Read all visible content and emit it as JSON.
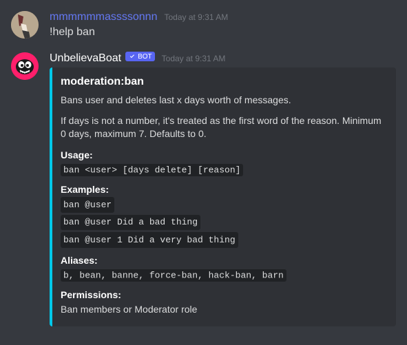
{
  "messages": {
    "user": {
      "username": "mmmmmmassssonnn",
      "username_color": "#6478f2",
      "timestamp": "Today at 9:31 AM",
      "text": "!help ban"
    },
    "bot": {
      "username": "UnbelievaBoat",
      "bot_tag_text": "BOT",
      "timestamp": "Today at 9:31 AM",
      "embed": {
        "accent_color": "#00c8e9",
        "title": "moderation:ban",
        "description_1": "Bans user and deletes last x days worth of messages.",
        "description_2": "If days is not a number, it's treated as the first word of the reason. Minimum 0 days, maximum 7. Defaults to 0.",
        "fields": {
          "usage": {
            "name": "Usage:",
            "value": "ban <user> [days delete] [reason]"
          },
          "examples": {
            "name": "Examples:",
            "values": [
              "ban @user",
              "ban @user Did a bad thing",
              "ban @user 1 Did a very bad thing"
            ]
          },
          "aliases": {
            "name": "Aliases:",
            "value": "b, bean, banne, force-ban, hack-ban, barn"
          },
          "permissions": {
            "name": "Permissions:",
            "value": "Ban members or Moderator role"
          }
        }
      }
    }
  }
}
